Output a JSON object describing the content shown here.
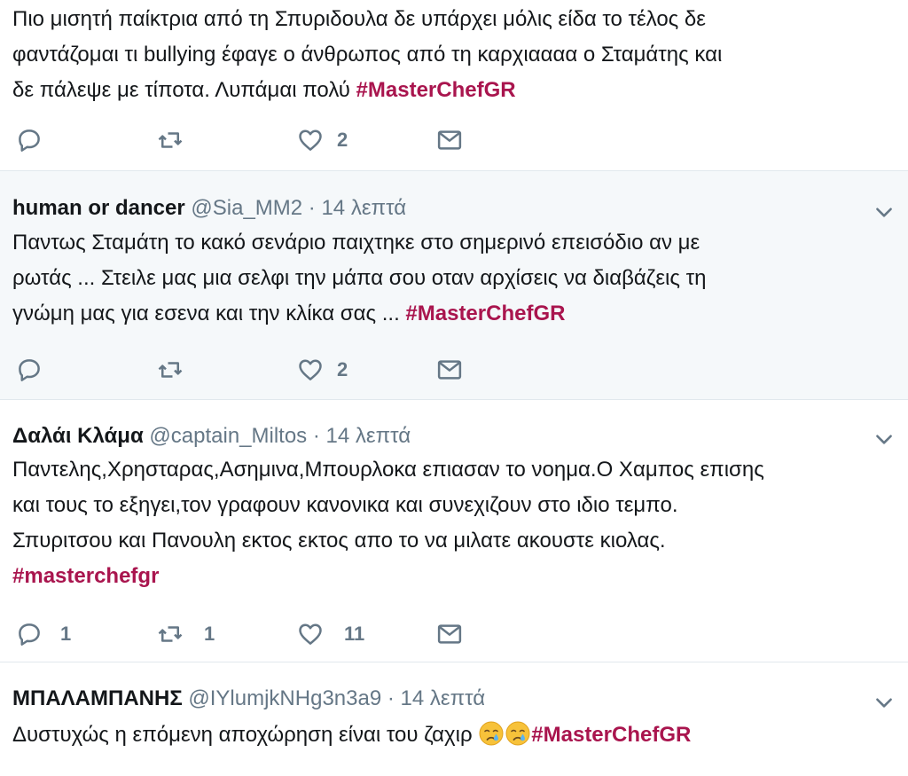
{
  "tweets": [
    {
      "text_lines": [
        "Πιο μισητή παίκτρια από τη Σπυριδουλα δε υπάρχει μόλις είδα το τέλος δε",
        "φαντάζομαι τι bullying έφαγε ο άνθρωπος από τη καρχιαααα ο Σταμάτης και",
        "δε πάλεψε με τίποτα. Λυπάμαι πολύ "
      ],
      "hashtag": "#MasterChefGR",
      "likes": "2"
    },
    {
      "name": "human or dancer",
      "handle": "@Sia_MM2",
      "time": "· 14 λεπτά",
      "text_lines": [
        "Παντως Σταμάτη το κακό σενάριο παιχτηκε στο σημερινό επεισόδιο αν με",
        "ρωτάς ... Στειλε μας μια σελφι την μάπα σου οταν αρχίσεις να διαβάζεις τη",
        "γνώμη μας για εσενα και την κλίκα σας ... "
      ],
      "hashtag": "#MasterChefGR",
      "likes": "2"
    },
    {
      "name": "Δαλάι Κλάμα",
      "handle": "@captain_Miltos",
      "time": "· 14 λεπτά",
      "text_lines": [
        "Παντελης,Χρησταρας,Ασημινα,Μπουρλοκα επιασαν το νοημα.Ο Χαμπος επισης",
        "και τους το εξηγει,τον γραφουν κανονικα και συνεχιζουν στο ιδιο τεμπο.",
        "Σπυριτσου και Πανουλη εκτος εκτος απο το να μιλατε ακουστε κιολας."
      ],
      "hashtag": "#masterchefgr",
      "replies": "1",
      "retweets": "1",
      "likes": "11"
    },
    {
      "name": "ΜΠΑΛΑΜΠΑΝΗΣ",
      "handle": "@IYlumjkNHg3n3a9",
      "time": "· 14 λεπτά",
      "text": "Δυστυχώς η επόμενη αποχώρηση είναι του ζαχιρ ",
      "hashtag": "#MasterChefGR",
      "emoji": "crying-face"
    }
  ],
  "colors": {
    "hashtag": "#a9154e",
    "meta": "#657786",
    "highlight_bg": "#f5f8fa"
  }
}
